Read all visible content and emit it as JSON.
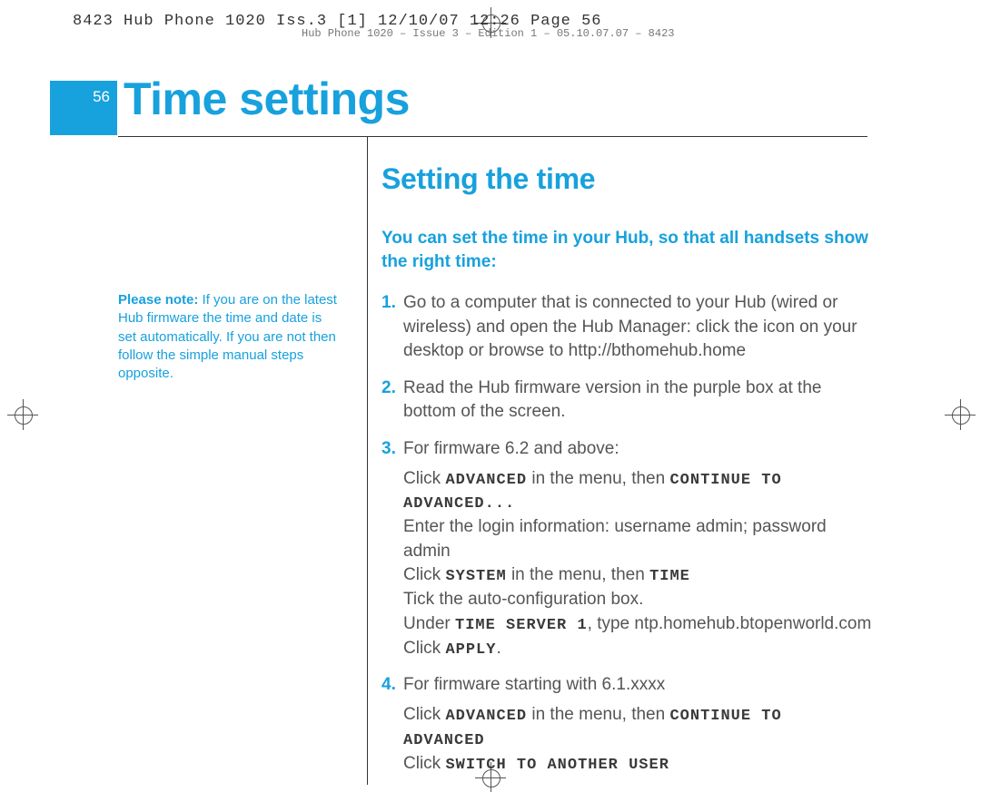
{
  "slug1": "8423 Hub Phone 1020 Iss.3 [1]  12/10/07  12:26  Page 56",
  "slug2": "Hub Phone 1020 – Issue 3 – Edition 1 – 05.10.07.07 – 8423",
  "page_number": "56",
  "chapter_title": "Time settings",
  "section_title": "Setting the time",
  "sidebar": {
    "label": "Please note:",
    "body": "If you are on the latest Hub firmware the time and date is set automatically. If you are not then follow the simple manual steps opposite."
  },
  "lead": "You can set the time in your Hub, so that all handsets show the right time:",
  "steps": {
    "s1": {
      "num": "1.",
      "text": "Go to a computer that is connected to your Hub (wired or wireless) and open the Hub Manager: click the icon on your desktop or browse to http://bthomehub.home"
    },
    "s2": {
      "num": "2.",
      "text": "Read the Hub firmware version in the purple box at the bottom of the screen."
    },
    "s3": {
      "num": "3.",
      "text": "For firmware 6.2 and above:",
      "sub": {
        "a_pre": "Click ",
        "a_ui1": "ADVANCED",
        "a_mid": " in the menu, then ",
        "a_ui2": "CONTINUE TO ADVANCED...",
        "b": "Enter the login information: username admin; password admin",
        "c_pre": "Click ",
        "c_ui1": "SYSTEM",
        "c_mid": " in the menu, then ",
        "c_ui2": "TIME",
        "d": "Tick the auto-configuration box.",
        "e_pre": "Under ",
        "e_ui": "TIME SERVER 1",
        "e_post": ", type ntp.homehub.btopenworld.com",
        "f_pre": "Click ",
        "f_ui": "APPLY",
        "f_post": "."
      }
    },
    "s4": {
      "num": "4.",
      "text": "For firmware starting with 6.1.xxxx",
      "sub": {
        "a_pre": "Click ",
        "a_ui1": "ADVANCED",
        "a_mid": " in the menu, then ",
        "a_ui2": "CONTINUE TO ADVANCED",
        "b_pre": "Click ",
        "b_ui": "SWITCH TO ANOTHER USER"
      }
    }
  }
}
